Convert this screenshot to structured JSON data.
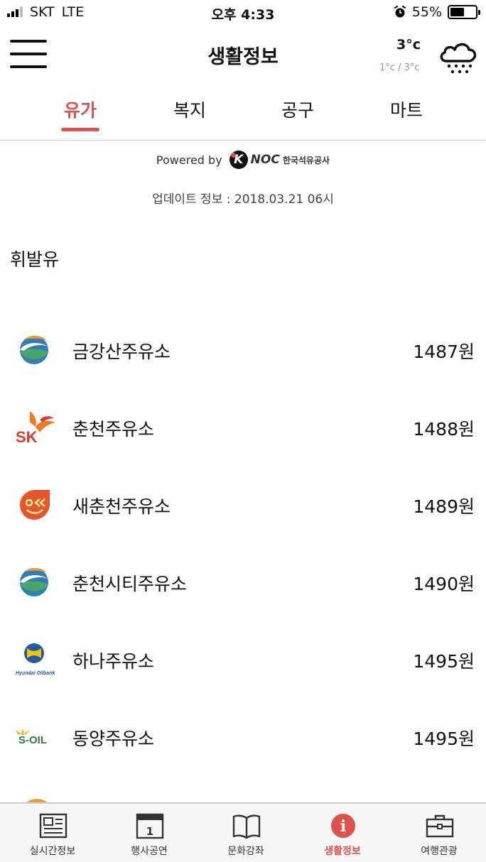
{
  "status_bar": {
    "carrier": "SKT",
    "network": "LTE",
    "time": "오후 4:33",
    "battery": "55%",
    "battery_level": 0.55,
    "icons": [
      "signal-icon",
      "alarm-icon",
      "battery-icon"
    ]
  },
  "header": {
    "title": "생활정보",
    "weather": {
      "temp": "3°c",
      "range": "1°c / 3°c",
      "icon": "snow-cloud-icon"
    }
  },
  "tabs": [
    {
      "label": "유가",
      "active": true
    },
    {
      "label": "복지",
      "active": false
    },
    {
      "label": "공구",
      "active": false
    },
    {
      "label": "마트",
      "active": false
    }
  ],
  "powered_by": {
    "label": "Powered by",
    "logo_mark": "K",
    "logo_text": "NOC",
    "logo_korean": "한국석유공사"
  },
  "update_info": "업데이트 정보 : 2018.03.21 06시",
  "section_title": "휘발유",
  "stations": [
    {
      "name": "금강산주유소",
      "price": "1487원",
      "brand_icon": "gs-caltex-icon"
    },
    {
      "name": "춘천주유소",
      "price": "1488원",
      "brand_icon": "sk-energy-icon"
    },
    {
      "name": "새춘천주유소",
      "price": "1489원",
      "brand_icon": "e1-icon"
    },
    {
      "name": "춘천시티주유소",
      "price": "1490원",
      "brand_icon": "gs-caltex-icon"
    },
    {
      "name": "하나주유소",
      "price": "1495원",
      "brand_icon": "hyundai-oilbank-icon",
      "brand_text": "Hyundai Oilbank"
    },
    {
      "name": "동양주유소",
      "price": "1495원",
      "brand_icon": "s-oil-icon",
      "brand_text": "S-OIL"
    }
  ],
  "bottom_nav": [
    {
      "label": "실시간정보",
      "icon": "news-icon",
      "active": false
    },
    {
      "label": "행사공연",
      "icon": "calendar-icon",
      "icon_text": "1",
      "active": false
    },
    {
      "label": "문화강좌",
      "icon": "book-icon",
      "active": false
    },
    {
      "label": "생활정보",
      "icon": "info-icon",
      "icon_text": "i",
      "active": true
    },
    {
      "label": "여행관광",
      "icon": "briefcase-icon",
      "active": false
    }
  ],
  "colors": {
    "accent": "#d9534f",
    "nav_active": "#e0514c"
  }
}
